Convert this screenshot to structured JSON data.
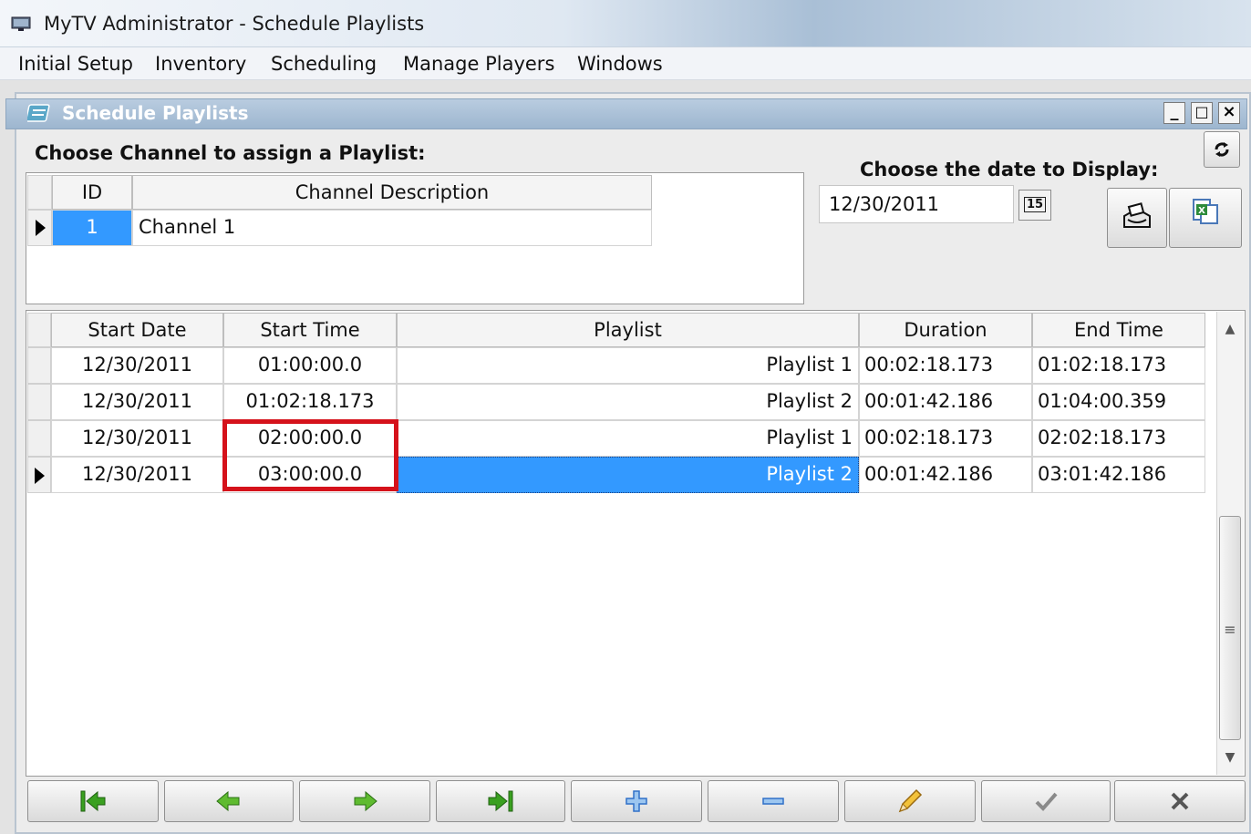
{
  "app": {
    "title": "MyTV Administrator - Schedule Playlists"
  },
  "menu": {
    "items": [
      "Initial Setup",
      "Inventory",
      "Scheduling",
      "Manage Players",
      "Windows"
    ]
  },
  "child_window": {
    "title": "Schedule Playlists",
    "min_label": "_",
    "max_label": "□",
    "close_label": "×"
  },
  "channel_section": {
    "heading": "Choose Channel to assign a Playlist:",
    "columns": [
      "ID",
      "Channel Description"
    ],
    "rows": [
      {
        "id": "1",
        "description": "Channel 1"
      }
    ]
  },
  "date_section": {
    "heading": "Choose the date to Display:",
    "date_value": "12/30/2011",
    "calendar_label": "15"
  },
  "schedule": {
    "columns": [
      "Start Date",
      "Start Time",
      "Playlist",
      "Duration",
      "End Time"
    ],
    "rows": [
      {
        "start_date": "12/30/2011",
        "start_time": "01:00:00.0",
        "playlist": "Playlist 1",
        "duration": "00:02:18.173",
        "end_time": "01:02:18.173"
      },
      {
        "start_date": "12/30/2011",
        "start_time": "01:02:18.173",
        "playlist": "Playlist 2",
        "duration": "00:01:42.186",
        "end_time": "01:04:00.359"
      },
      {
        "start_date": "12/30/2011",
        "start_time": "02:00:00.0",
        "playlist": "Playlist 1",
        "duration": "00:02:18.173",
        "end_time": "02:02:18.173"
      },
      {
        "start_date": "12/30/2011",
        "start_time": "03:00:00.0",
        "playlist": "Playlist 2",
        "duration": "00:01:42.186",
        "end_time": "03:01:42.186"
      }
    ],
    "selected_row": 3
  },
  "icons": {
    "refresh": "refresh-icon",
    "print": "print-icon",
    "excel": "excel-export-icon",
    "first": "first-record-icon",
    "prev": "previous-record-icon",
    "next": "next-record-icon",
    "last": "last-record-icon",
    "add": "add-icon",
    "delete": "delete-icon",
    "edit": "edit-icon",
    "post": "post-icon",
    "cancel": "cancel-icon"
  },
  "colors": {
    "selection": "#3399ff",
    "highlight_box": "#d5121b",
    "green_arrow": "#3aa020",
    "blue_plus": "#3070c8"
  }
}
